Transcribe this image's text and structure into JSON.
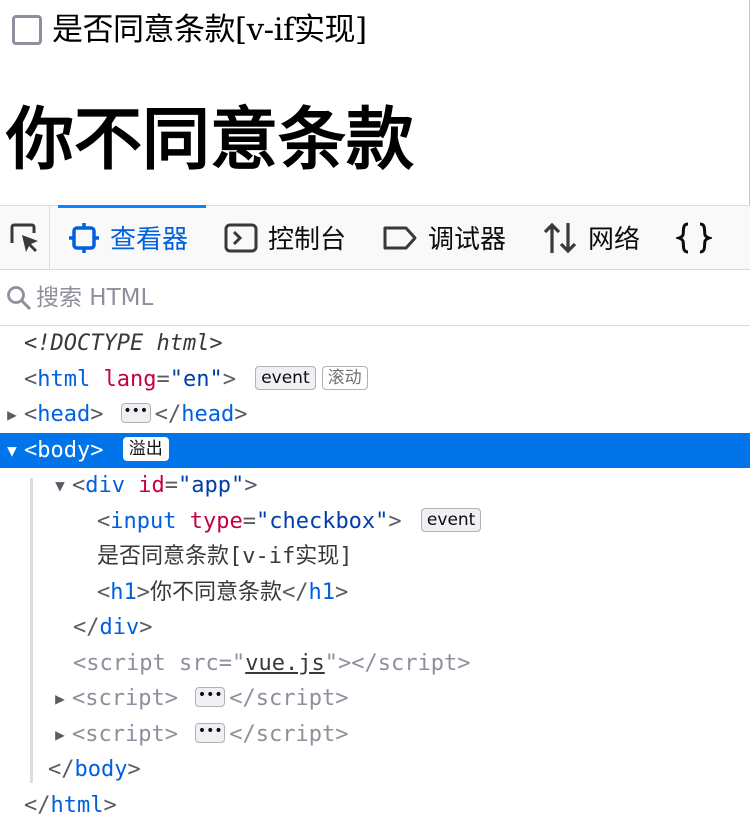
{
  "page": {
    "checkbox_label": "是否同意条款[v-if实现]",
    "heading": "你不同意条款"
  },
  "devtools": {
    "tabs": [
      {
        "label": "查看器",
        "icon": "inspector-icon",
        "active": true
      },
      {
        "label": "控制台",
        "icon": "console-icon"
      },
      {
        "label": "调试器",
        "icon": "debugger-icon"
      },
      {
        "label": "网络",
        "icon": "network-icon"
      },
      {
        "label": "",
        "icon": "style-editor-icon"
      }
    ],
    "search_placeholder": "搜索 HTML",
    "colors": {
      "accent": "#0a84ff",
      "selection": "#0074e8",
      "tag": "#0060df",
      "attr": "#c50042",
      "value": "#003eaa"
    }
  },
  "tree": {
    "doctype": "<!DOCTYPE html>",
    "html_open_tag": "html",
    "html_attr": "lang",
    "html_attr_val": "\"en\"",
    "badge_event": "event",
    "badge_scroll": "滚动",
    "head_tag": "head",
    "body_tag": "body",
    "badge_overflow": "溢出",
    "div_tag": "div",
    "div_attr": "id",
    "div_attr_val": "\"app\"",
    "input_tag": "input",
    "input_attr": "type",
    "input_attr_val": "\"checkbox\"",
    "text_node": "是否同意条款[v-if实现]",
    "h1_tag": "h1",
    "h1_text": "你不同意条款",
    "script_tag": "script",
    "script_attr": "src",
    "script_src": "vue.js",
    "lt": "<",
    "gt": ">",
    "lt_slash": "</",
    "eq": "=",
    "quote": "\"",
    "ellipsis": "•••"
  }
}
